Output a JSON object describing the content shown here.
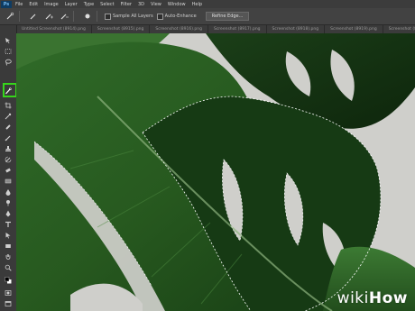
{
  "app": {
    "logo": "Ps"
  },
  "menu": [
    "File",
    "Edit",
    "Image",
    "Layer",
    "Type",
    "Select",
    "Filter",
    "3D",
    "View",
    "Window",
    "Help"
  ],
  "options": {
    "sample_all_layers": "Sample All Layers",
    "auto_enhance": "Auto-Enhance",
    "refine_edge": "Refine Edge..."
  },
  "tabs": [
    "Untitled Screenshot (8914).png",
    "Screenshot (8915).png",
    "Screenshot (8916).png",
    "Screenshot (8917).png",
    "Screenshot (8918).png",
    "Screenshot (8919).png",
    "Screenshot (892..."
  ],
  "tools": [
    "move-icon",
    "marquee-icon",
    "lasso-icon",
    "quick-selection-icon",
    "crop-icon",
    "eyedropper-icon",
    "healing-icon",
    "brush-icon",
    "clone-stamp-icon",
    "history-brush-icon",
    "eraser-icon",
    "gradient-icon",
    "blur-icon",
    "dodge-icon",
    "pen-icon",
    "type-icon",
    "path-selection-icon",
    "rectangle-icon",
    "hand-icon",
    "zoom-icon",
    "colors-icon",
    "quick-mask-icon",
    "screen-mode-icon"
  ],
  "watermark": {
    "wiki": "wiki",
    "how": "How"
  },
  "colors": {
    "highlight": "#36d51b",
    "leaf_dark": "#1f4a1c",
    "leaf_mid": "#2f6a28",
    "background": "#cfcfcb"
  }
}
